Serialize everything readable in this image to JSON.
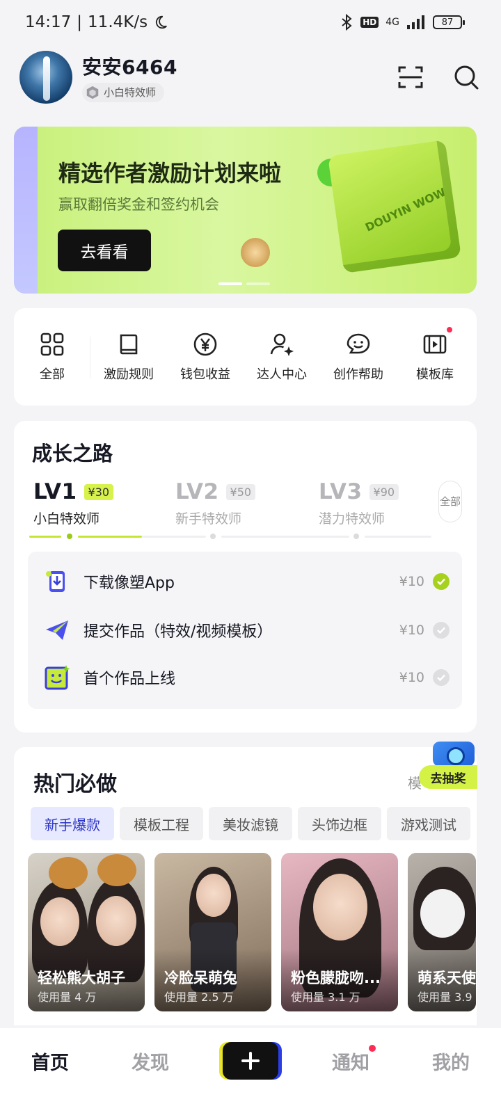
{
  "status_bar": {
    "time": "14:17",
    "network_speed": "11.4K/s",
    "moon_icon": "moon-icon",
    "signal": "4G",
    "hd": "HD",
    "battery": "87"
  },
  "header": {
    "username": "安安6464",
    "level_badge": "小白特效师",
    "scan_icon": "scan-icon",
    "search_icon": "search-icon"
  },
  "banner": {
    "title": "精选作者激励计划来啦",
    "subtitle": "赢取翻倍奖金和签约机会",
    "button": "去看看",
    "art_text": "DOUYIN WOW"
  },
  "menu": [
    {
      "label": "全部",
      "icon": "grid-icon"
    },
    {
      "label": "激励规则",
      "icon": "book-icon"
    },
    {
      "label": "钱包收益",
      "icon": "yen-coin-icon"
    },
    {
      "label": "达人中心",
      "icon": "user-star-icon"
    },
    {
      "label": "创作帮助",
      "icon": "chat-smile-icon"
    },
    {
      "label": "模板库",
      "icon": "film-icon",
      "badge": true
    }
  ],
  "growth": {
    "title": "成长之路",
    "levels": [
      {
        "lv": "LV1",
        "reward": "¥30",
        "name": "小白特效师",
        "active": true
      },
      {
        "lv": "LV2",
        "reward": "¥50",
        "name": "新手特效师",
        "active": false
      },
      {
        "lv": "LV3",
        "reward": "¥90",
        "name": "潜力特效师",
        "active": false
      }
    ],
    "all_button": "全部",
    "tasks": [
      {
        "label": "下载像塑App",
        "reward": "¥10",
        "done": true,
        "icon": "download-app-icon"
      },
      {
        "label": "提交作品（特效/视频模板）",
        "reward": "¥10",
        "done": false,
        "icon": "paper-plane-icon"
      },
      {
        "label": "首个作品上线",
        "reward": "¥10",
        "done": false,
        "icon": "smile-frame-icon"
      }
    ]
  },
  "hot": {
    "title": "热门必做",
    "more": "模",
    "lottery": "去抽奖",
    "tabs": [
      "新手爆款",
      "模板工程",
      "美妆滤镜",
      "头饰边框",
      "游戏测试"
    ],
    "cards": [
      {
        "name": "轻松熊大胡子",
        "usage": "使用量 4 万"
      },
      {
        "name": "冷脸呆萌兔",
        "usage": "使用量 2.5 万"
      },
      {
        "name": "粉色朦胧吻...",
        "usage": "使用量 3.1 万"
      },
      {
        "name": "萌系天使",
        "usage": "使用量 3.9"
      }
    ]
  },
  "bottom_nav": {
    "home": "首页",
    "discover": "发现",
    "plus_icon": "plus-icon",
    "notify": "通知",
    "me": "我的"
  }
}
